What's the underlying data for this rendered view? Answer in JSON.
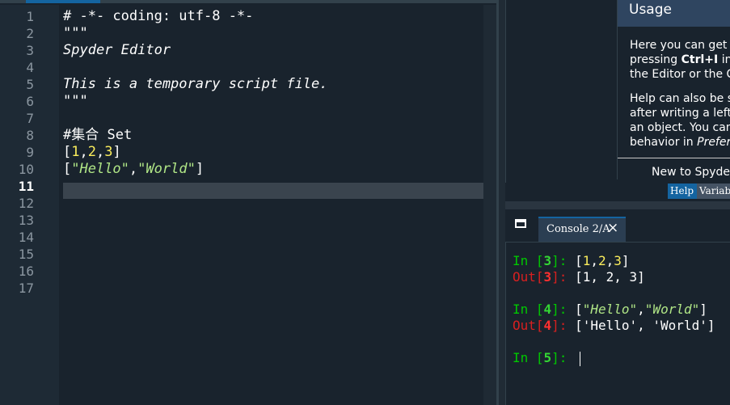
{
  "editor": {
    "line_numbers": [
      "1",
      "2",
      "3",
      "4",
      "5",
      "6",
      "7",
      "8",
      "9",
      "10",
      "11",
      "12",
      "13",
      "14",
      "15",
      "16",
      "17"
    ],
    "current_line": "11",
    "lines": {
      "l1": "# -*- coding: utf-8 -*-",
      "l2": "\"\"\"",
      "l3": "Spyder Editor",
      "l5": "This is a temporary script file.",
      "l6": "\"\"\"",
      "l8": "#集合 Set",
      "l9": {
        "open": "[",
        "n1": "1",
        "c1": ",",
        "n2": "2",
        "c2": ",",
        "n3": "3",
        "close": "]"
      },
      "l10": {
        "open": "[",
        "s1": "\"Hello\"",
        "c1": ",",
        "s2": "\"World\"",
        "close": "]"
      }
    }
  },
  "help": {
    "title": "Usage",
    "p1": [
      "Here you can get help of any object by",
      "pressing Ctrl+I in front of it, either on",
      "the Editor or the Console."
    ],
    "p1_bold": "Ctrl+I",
    "p2": [
      "Help can also be shown automatically",
      "after writing a left parenthesis next to",
      "an object. You can activate this",
      "behavior in Preferences > Help."
    ],
    "p2_em": "Preferences > Help",
    "new_to": "New to Spyder? Read our tutorial",
    "tabs": {
      "help": "Help",
      "variables": "Variable Explorer"
    }
  },
  "console": {
    "tab_label": "Console 2/A",
    "close_icon": "×",
    "entries": {
      "in3_prompt": "In [",
      "in3_num": "3",
      "in3_end": "]: ",
      "in3_code": {
        "open": "[",
        "n1": "1",
        "c1": ",",
        "n2": "2",
        "c2": ",",
        "n3": "3",
        "close": "]"
      },
      "out3_prompt": "Out[",
      "out3_num": "3",
      "out3_end": "]: ",
      "out3_val": "[1, 2, 3]",
      "in4_prompt": "In [",
      "in4_num": "4",
      "in4_end": "]: ",
      "in4_code": {
        "open": "[",
        "s1": "\"Hello\"",
        "c1": ",",
        "s2": "\"World\"",
        "close": "]"
      },
      "out4_prompt": "Out[",
      "out4_num": "4",
      "out4_end": "]: ",
      "out4_val": "['Hello', 'World']",
      "in5_prompt": "In [",
      "in5_num": "5",
      "in5_end": "]: "
    }
  },
  "colors": {
    "background": "#19232d",
    "accent": "#1464a0",
    "string": "#b0e686",
    "number": "#faed5c",
    "comment": "#999999",
    "prompt_in": "#00c800",
    "prompt_out": "#d72020"
  }
}
